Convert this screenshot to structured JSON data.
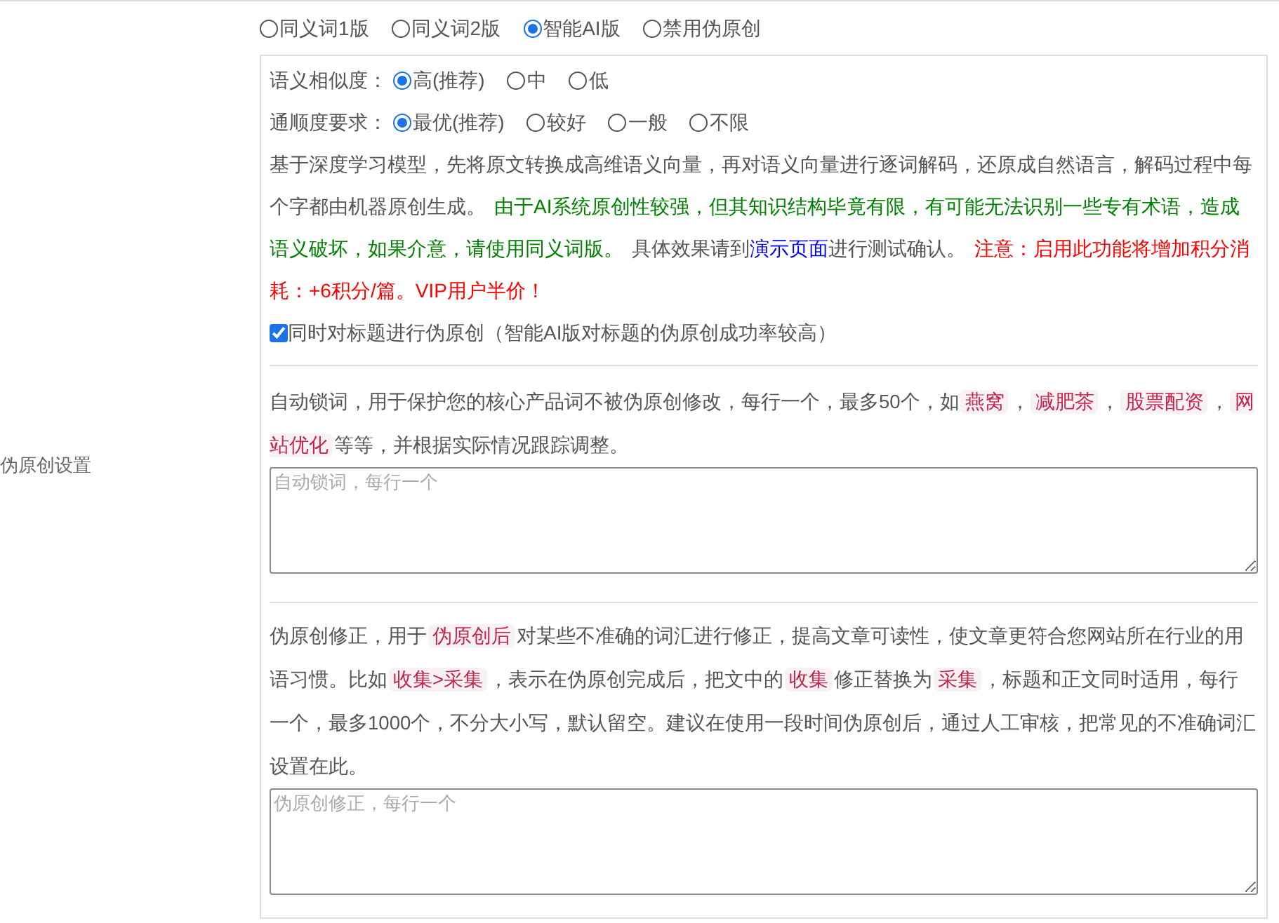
{
  "mode_options": [
    {
      "label": "同义词1版",
      "selected": false
    },
    {
      "label": "同义词2版",
      "selected": false
    },
    {
      "label": "智能AI版",
      "selected": true
    },
    {
      "label": "禁用伪原创",
      "selected": false
    }
  ],
  "similarity": {
    "label": "语义相似度：",
    "options": [
      {
        "label": "高(推荐)",
        "selected": true
      },
      {
        "label": "中",
        "selected": false
      },
      {
        "label": "低",
        "selected": false
      }
    ]
  },
  "fluency": {
    "label": "通顺度要求：",
    "options": [
      {
        "label": "最优(推荐)",
        "selected": true
      },
      {
        "label": "较好",
        "selected": false
      },
      {
        "label": "一般",
        "selected": false
      },
      {
        "label": "不限",
        "selected": false
      }
    ]
  },
  "description": [
    {
      "kind": "text",
      "text": "基于深度学习模型，先将原文转换成高维语义向量，再对语义向量进行逐词解码，还原成自然语言，解码过程中每个字都由机器原创生成。"
    },
    {
      "kind": "note",
      "text": "由于AI系统原创性较强，但其知识结构毕竟有限，有可能无法识别一些专有术语，造成语义破坏，如果介意，请使用同义词版。"
    },
    {
      "kind": "text",
      "text": "具体效果请到"
    },
    {
      "kind": "link",
      "text": "演示页面"
    },
    {
      "kind": "text",
      "text": "进行测试确认。"
    },
    {
      "kind": "warning",
      "text": "注意：启用此功能将增加积分消耗：+6积分/篇。VIP用户半价！"
    }
  ],
  "title_option": {
    "label": "同时对标题进行伪原创（智能AI版对标题的伪原创成功率较高）",
    "checked": true
  },
  "side_label": "伪原创设置",
  "lock_words": {
    "segments": [
      {
        "kind": "text",
        "text": "自动锁词，用于保护您的核心产品词不被伪原创修改，每行一个，最多50个，如"
      },
      {
        "kind": "tag",
        "text": "燕窝"
      },
      {
        "kind": "text",
        "text": "，"
      },
      {
        "kind": "tag",
        "text": "减肥茶"
      },
      {
        "kind": "text",
        "text": "，"
      },
      {
        "kind": "tag",
        "text": "股票配资"
      },
      {
        "kind": "text",
        "text": "，"
      },
      {
        "kind": "tag",
        "text": "网站优化"
      },
      {
        "kind": "text",
        "text": "等等，并根据实际情况跟踪调整。"
      }
    ],
    "placeholder": "自动锁词，每行一个"
  },
  "correction": {
    "segments": [
      {
        "kind": "text",
        "text": "伪原创修正，用于"
      },
      {
        "kind": "tag",
        "text": "伪原创后"
      },
      {
        "kind": "text",
        "text": "对某些不准确的词汇进行修正，提高文章可读性，使文章更符合您网站所在行业的用语习惯。比如"
      },
      {
        "kind": "tag",
        "text": "收集>采集"
      },
      {
        "kind": "text",
        "text": "，表示在伪原创完成后，把文中的"
      },
      {
        "kind": "tag",
        "text": "收集"
      },
      {
        "kind": "text",
        "text": "修正替换为"
      },
      {
        "kind": "tag",
        "text": "采集"
      },
      {
        "kind": "text",
        "text": "，标题和正文同时适用，每行一个，最多1000个，不分大小写，默认留空。建议在使用一段时间伪原创后，通过人工审核，把常见的不准确词汇设置在此。"
      }
    ],
    "placeholder": "伪原创修正，每行一个"
  }
}
